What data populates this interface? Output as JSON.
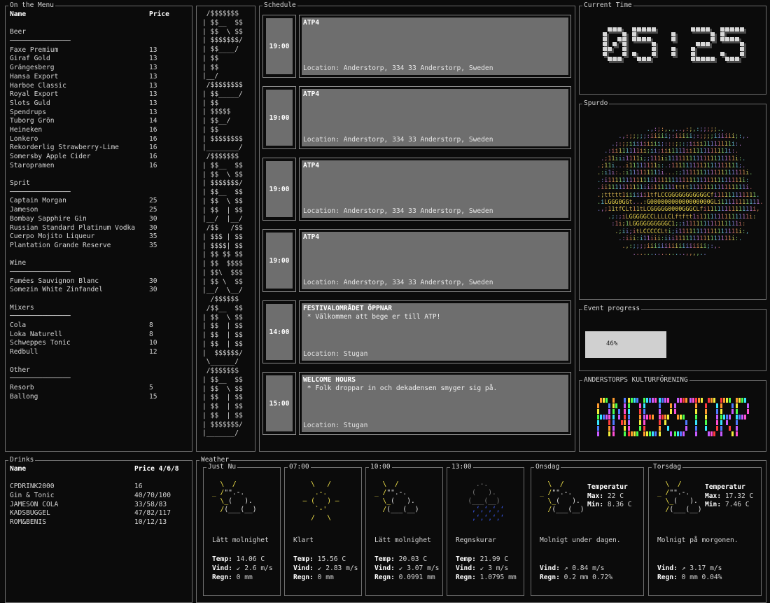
{
  "menu": {
    "title": "On the Menu",
    "header": {
      "name": "Name",
      "price": "Price"
    },
    "sections": [
      {
        "name": "Beer",
        "divider": "───────────────",
        "items": [
          {
            "name": "Faxe Premium",
            "price": "13"
          },
          {
            "name": "Giraf Gold",
            "price": "13"
          },
          {
            "name": "Grängesberg",
            "price": "13"
          },
          {
            "name": "Hansa Export",
            "price": "13"
          },
          {
            "name": "Harboe Classic",
            "price": "13"
          },
          {
            "name": "Royal Export",
            "price": "13"
          },
          {
            "name": "Slots Guld",
            "price": "13"
          },
          {
            "name": "Spendrups",
            "price": "13"
          },
          {
            "name": "Tuborg Grön",
            "price": "14"
          },
          {
            "name": "Heineken",
            "price": "16"
          },
          {
            "name": "Lonkero",
            "price": "16"
          },
          {
            "name": "Rekorderlig Strawberry-Lime",
            "price": "16"
          },
          {
            "name": "Somersby Apple Cider",
            "price": "16"
          },
          {
            "name": "Staropramen",
            "price": "16"
          }
        ]
      },
      {
        "name": "Sprit",
        "divider": "───────────────",
        "items": [
          {
            "name": "Captain Morgan",
            "price": "25"
          },
          {
            "name": "Jameson",
            "price": "25"
          },
          {
            "name": "Bombay Sapphire Gin",
            "price": "30"
          },
          {
            "name": "Russian Standard Platinum Vodka",
            "price": "30"
          },
          {
            "name": "Cuerpo Mojito Liqueur",
            "price": "35"
          },
          {
            "name": "Plantation Grande Reserve",
            "price": "35"
          }
        ]
      },
      {
        "name": "Wine",
        "divider": "───────────────",
        "items": [
          {
            "name": "Fumées Sauvignon Blanc",
            "price": "30"
          },
          {
            "name": "Somezin White Zinfandel",
            "price": "30"
          }
        ]
      },
      {
        "name": "Mixers",
        "divider": "───────────────",
        "items": [
          {
            "name": "Cola",
            "price": "8"
          },
          {
            "name": "Loka Naturell",
            "price": "8"
          },
          {
            "name": "Schweppes Tonic",
            "price": "10"
          },
          {
            "name": "Redbull",
            "price": "12"
          }
        ]
      },
      {
        "name": "Other",
        "divider": "───────────────",
        "items": [
          {
            "name": "Resorb",
            "price": "5"
          },
          {
            "name": "Ballong",
            "price": "15"
          }
        ]
      }
    ]
  },
  "banner_ascii": " /$$$$$$$\n| $$__  $$\n| $$  \\ $$\n| $$$$$$$/\n| $$____/\n| $$\n| $$\n|__/\n /$$$$$$$$\n| $$_____/\n| $$\n| $$$$$\n| $$__/\n| $$\n| $$$$$$$$\n|________/\n /$$$$$$$\n| $$__  $$\n| $$  \\ $$\n| $$$$$$$/\n| $$__  $$\n| $$  \\ $$\n| $$  | $$\n|__/  |__/\n /$$   /$$\n| $$$ | $$\n| $$$$| $$\n| $$ $$ $$\n| $$  $$$$\n| $$\\  $$$\n| $$ \\  $$\n|__/  \\__/\n  /$$$$$$\n /$$__  $$\n| $$  \\ $$\n| $$  | $$\n| $$  | $$\n| $$  | $$\n|  $$$$$$/\n \\______/\n /$$$$$$$\n| $$__  $$\n| $$  \\ $$\n| $$  | $$\n| $$  | $$\n| $$  | $$\n| $$$$$$$/\n|_______/",
  "schedule": {
    "title": "Schedule",
    "events": [
      {
        "time": "19:00",
        "title": "ATP4",
        "desc": "",
        "location": "Location: Anderstorp, 334 33 Anderstorp, Sweden"
      },
      {
        "time": "19:00",
        "title": "ATP4",
        "desc": "",
        "location": "Location: Anderstorp, 334 33 Anderstorp, Sweden"
      },
      {
        "time": "19:00",
        "title": "ATP4",
        "desc": "",
        "location": "Location: Anderstorp, 334 33 Anderstorp, Sweden"
      },
      {
        "time": "19:00",
        "title": "ATP4",
        "desc": "",
        "location": "Location: Anderstorp, 334 33 Anderstorp, Sweden"
      },
      {
        "time": "14:00",
        "title": "FESTIVALOMRÅDET ÖPPNAR",
        "desc": " * Välkommen att bege er till ATP!",
        "location": "Location: Stugan"
      },
      {
        "time": "15:00",
        "title": "WELCOME HOURS",
        "desc": " * Folk droppar in och dekadensen smyger sig på.",
        "location": "Location: Stugan"
      }
    ]
  },
  "clock": {
    "title": "Current Time",
    "time": "05:25"
  },
  "spurdo": {
    "title": "Spurdo"
  },
  "progress": {
    "title": "Event progress",
    "value": 46,
    "label": "46%"
  },
  "kultur": {
    "title": "ANDERSTORPS KULTURFÖRENING",
    "logo_text": "ANDERSTORP"
  },
  "drinks": {
    "title": "Drinks",
    "header": {
      "name": "Name",
      "price": "Price 4/6/8"
    },
    "items": [
      {
        "name": "CPDRINK2000",
        "price": "16"
      },
      {
        "name": "Gin & Tonic",
        "price": "40/70/100"
      },
      {
        "name": "JAMESON COLA",
        "price": "33/58/83"
      },
      {
        "name": "KADSBUGGEL",
        "price": "47/82/117"
      },
      {
        "name": "ROM&BENIS",
        "price": "10/12/13"
      }
    ]
  },
  "weather": {
    "title": "Weather",
    "cards": [
      {
        "label": "Just Nu",
        "icon": "partly-cloudy",
        "desc": "Lätt molnighet",
        "temp_k": "Temp:",
        "temp": "14.06 C",
        "wind_k": "Vind:",
        "wind": "↙ 2.6 m/s",
        "rain_k": "Regn:",
        "rain": "0 mm"
      },
      {
        "label": "07:00",
        "icon": "sunny",
        "desc": "Klart",
        "temp_k": "Temp:",
        "temp": "15.56 C",
        "wind_k": "Vind:",
        "wind": "↙ 2.83 m/s",
        "rain_k": "Regn:",
        "rain": "0 mm"
      },
      {
        "label": "10:00",
        "icon": "partly-cloudy",
        "desc": "Lätt molnighet",
        "temp_k": "Temp:",
        "temp": "20.03 C",
        "wind_k": "Vind:",
        "wind": "↙ 3.07 m/s",
        "rain_k": "Regn:",
        "rain": "0.0991 mm"
      },
      {
        "label": "13:00",
        "icon": "rain",
        "desc": "Regnskurar",
        "temp_k": "Temp:",
        "temp": "21.99 C",
        "wind_k": "Vind:",
        "wind": "↙ 3 m/s",
        "rain_k": "Regn:",
        "rain": "1.0795 mm"
      }
    ],
    "days": [
      {
        "label": "Onsdag",
        "icon": "partly-cloudy",
        "temp_title": "Temperatur",
        "max_k": "Max:",
        "max": "22 C",
        "min_k": "Min:",
        "min": "8.36 C",
        "desc": "Molnigt under dagen.",
        "wind_k": "Vind:",
        "wind": "↗ 0.84 m/s",
        "rain_k": "Regn:",
        "rain": "0.2 mm 0.72%"
      },
      {
        "label": "Torsdag",
        "icon": "partly-cloudy",
        "temp_title": "Temperatur",
        "max_k": "Max:",
        "max": "17.32 C",
        "min_k": "Min:",
        "min": "7.46 C",
        "desc": "Molnigt på morgonen.",
        "wind_k": "Vind:",
        "wind": "↗ 3.17 m/s",
        "rain_k": "Regn:",
        "rain": "0 mm 0.04%"
      }
    ]
  }
}
